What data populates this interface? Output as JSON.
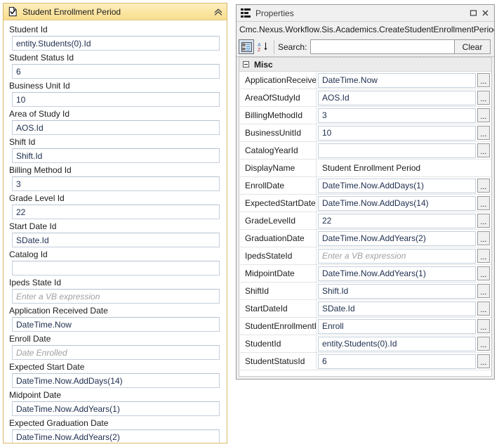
{
  "activity": {
    "title": "Student Enrollment Period",
    "icon": "document-check-icon",
    "collapse_icon": "chevron-double-up-icon",
    "accent_color": "#f8dd8f",
    "border_color": "#d8b96a",
    "fields": [
      {
        "label": "Student Id",
        "value": "entity.Students(0).Id",
        "placeholder": ""
      },
      {
        "label": "Student Status Id",
        "value": "6",
        "placeholder": ""
      },
      {
        "label": "Business Unit Id",
        "value": "10",
        "placeholder": ""
      },
      {
        "label": "Area of Study Id",
        "value": "AOS.Id",
        "placeholder": ""
      },
      {
        "label": "Shift Id",
        "value": "Shift.Id",
        "placeholder": ""
      },
      {
        "label": "Billing Method Id",
        "value": "3",
        "placeholder": ""
      },
      {
        "label": "Grade Level Id",
        "value": "22",
        "placeholder": ""
      },
      {
        "label": "Start Date Id",
        "value": "SDate.Id",
        "placeholder": ""
      },
      {
        "label": "Catalog Id",
        "value": "",
        "placeholder": ""
      },
      {
        "label": "Ipeds State Id",
        "value": "",
        "placeholder": "Enter a VB expression"
      },
      {
        "label": "Application Received Date",
        "value": "DateTime.Now",
        "placeholder": ""
      },
      {
        "label": "Enroll Date",
        "value": "",
        "placeholder": "Date Enrolled"
      },
      {
        "label": "Expected Start Date",
        "value": "DateTime.Now.AddDays(14)",
        "placeholder": ""
      },
      {
        "label": "Midpoint Date",
        "value": "DateTime.Now.AddYears(1)",
        "placeholder": ""
      },
      {
        "label": "Expected Graduation Date",
        "value": "DateTime.Now.AddYears(2)",
        "placeholder": ""
      }
    ]
  },
  "properties": {
    "title": "Properties",
    "title_icon": "property-grid-icon",
    "maximize_icon": "maximize-icon",
    "close_icon": "close-icon",
    "type_name": "Cmc.Nexus.Workflow.Sis.Academics.CreateStudentEnrollmentPeriod",
    "toolbar": {
      "categorized_icon": "categorized-view-icon",
      "alphabetical_icon": "sort-alphabetical-icon",
      "search_label": "Search:",
      "search_value": "",
      "search_placeholder": "",
      "clear_label": "Clear"
    },
    "category": {
      "name": "Misc",
      "expander_icon": "collapse-box-icon",
      "expanded": true
    },
    "rows": [
      {
        "name": "ApplicationReceive...",
        "value": "DateTime.Now",
        "placeholder": "",
        "has_ellipsis": true,
        "editable": true
      },
      {
        "name": "AreaOfStudyId",
        "value": "AOS.Id",
        "placeholder": "",
        "has_ellipsis": true,
        "editable": true
      },
      {
        "name": "BillingMethodId",
        "value": "3",
        "placeholder": "",
        "has_ellipsis": true,
        "editable": true
      },
      {
        "name": "BusinessUnitId",
        "value": "10",
        "placeholder": "",
        "has_ellipsis": true,
        "editable": true
      },
      {
        "name": "CatalogYearId",
        "value": "",
        "placeholder": "",
        "has_ellipsis": true,
        "editable": true
      },
      {
        "name": "DisplayName",
        "value": "Student Enrollment Period",
        "placeholder": "",
        "has_ellipsis": false,
        "editable": false
      },
      {
        "name": "EnrollDate",
        "value": "DateTime.Now.AddDays(1)",
        "placeholder": "",
        "has_ellipsis": true,
        "editable": true
      },
      {
        "name": "ExpectedStartDate",
        "value": "DateTime.Now.AddDays(14)",
        "placeholder": "",
        "has_ellipsis": true,
        "editable": true
      },
      {
        "name": "GradeLevelId",
        "value": "22",
        "placeholder": "",
        "has_ellipsis": true,
        "editable": true
      },
      {
        "name": "GraduationDate",
        "value": "DateTime.Now.AddYears(2)",
        "placeholder": "",
        "has_ellipsis": true,
        "editable": true
      },
      {
        "name": "IpedsStateId",
        "value": "",
        "placeholder": "Enter a VB expression",
        "has_ellipsis": true,
        "editable": true
      },
      {
        "name": "MidpointDate",
        "value": "DateTime.Now.AddYears(1)",
        "placeholder": "",
        "has_ellipsis": true,
        "editable": true
      },
      {
        "name": "ShiftId",
        "value": "Shift.Id",
        "placeholder": "",
        "has_ellipsis": true,
        "editable": true
      },
      {
        "name": "StartDateId",
        "value": "SDate.Id",
        "placeholder": "",
        "has_ellipsis": true,
        "editable": true
      },
      {
        "name": "StudentEnrollmentP...",
        "value": "Enroll",
        "placeholder": "",
        "has_ellipsis": true,
        "editable": true
      },
      {
        "name": "StudentId",
        "value": "entity.Students(0).Id",
        "placeholder": "",
        "has_ellipsis": true,
        "editable": true
      },
      {
        "name": "StudentStatusId",
        "value": "6",
        "placeholder": "",
        "has_ellipsis": true,
        "editable": true
      }
    ]
  }
}
